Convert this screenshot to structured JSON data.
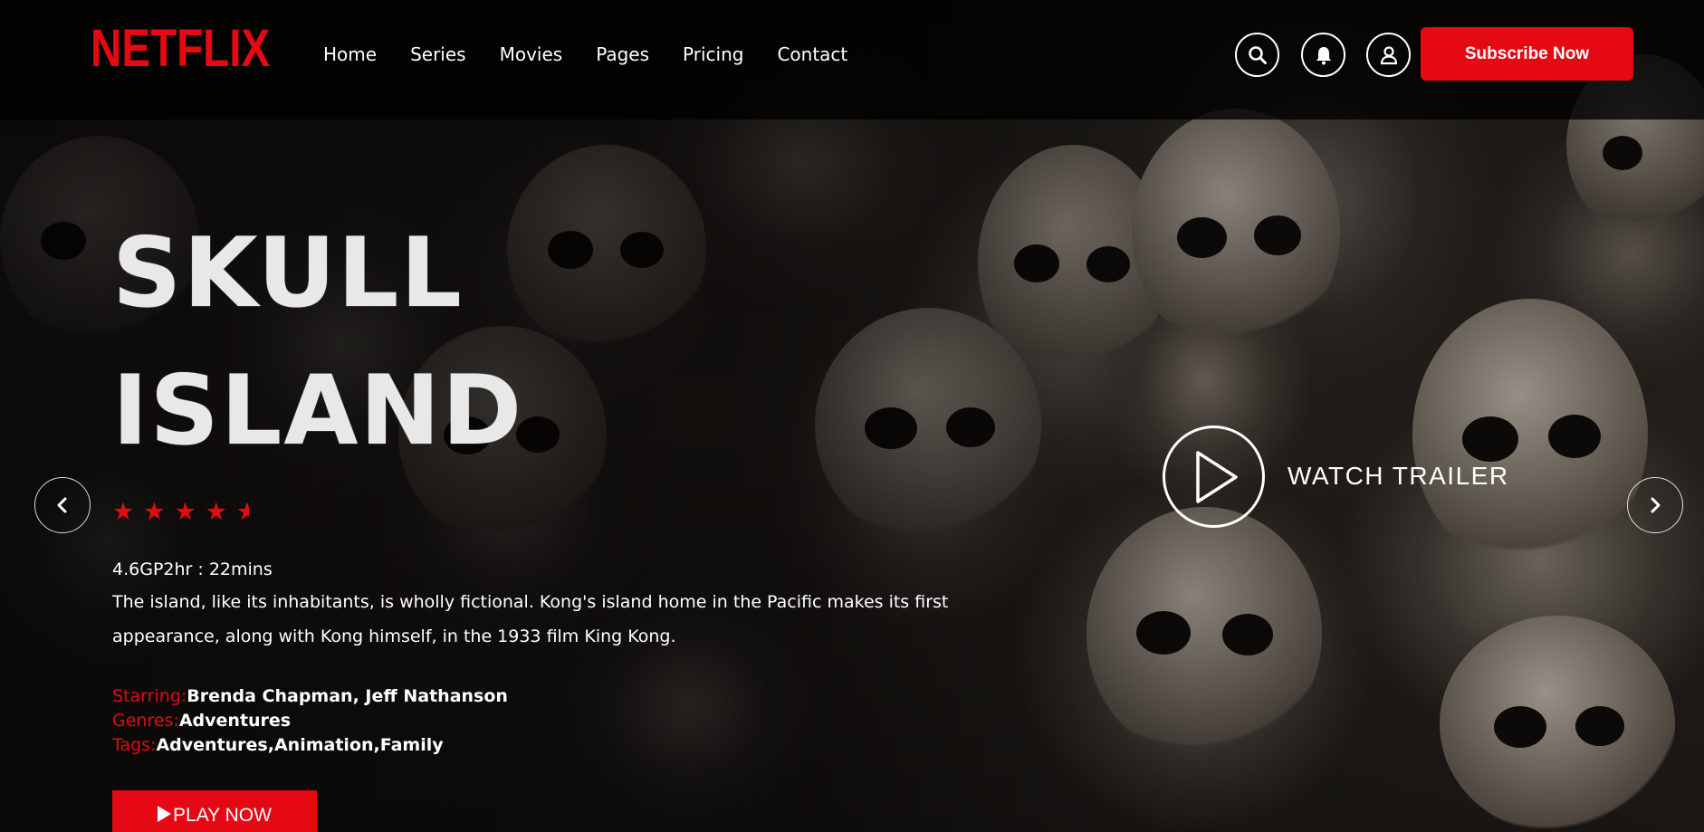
{
  "brand": {
    "logo_text": "NETFLIX",
    "accent_color": "#e50914"
  },
  "nav": {
    "items": [
      {
        "label": "Home"
      },
      {
        "label": "Series"
      },
      {
        "label": "Movies"
      },
      {
        "label": "Pages"
      },
      {
        "label": "Pricing"
      },
      {
        "label": "Contact"
      }
    ]
  },
  "header_actions": {
    "search_icon": "search-icon",
    "notification_icon": "bell-icon",
    "profile_icon": "user-icon",
    "subscribe_label": "Subscribe Now"
  },
  "hero": {
    "title_line1": "SKULL",
    "title_line2": "ISLAND",
    "rating_stars": 4.5,
    "meta": "4.6GP2hr : 22mins",
    "description": "The island, like its inhabitants, is wholly fictional. Kong's island home in the Pacific makes its first appearance, along with Kong himself, in the 1933 film King Kong.",
    "starring_label": "Starring:",
    "starring_value": "Brenda Chapman, Jeff Nathanson",
    "genres_label": "Genres:",
    "genres_value": "Adventures",
    "tags_label": "Tags:",
    "tags_value": "Adventures,Animation,Family",
    "play_label": "PLAY NOW",
    "trailer_label": "WATCH TRAILER"
  },
  "carousel": {
    "prev_icon": "chevron-left-icon",
    "next_icon": "chevron-right-icon"
  }
}
